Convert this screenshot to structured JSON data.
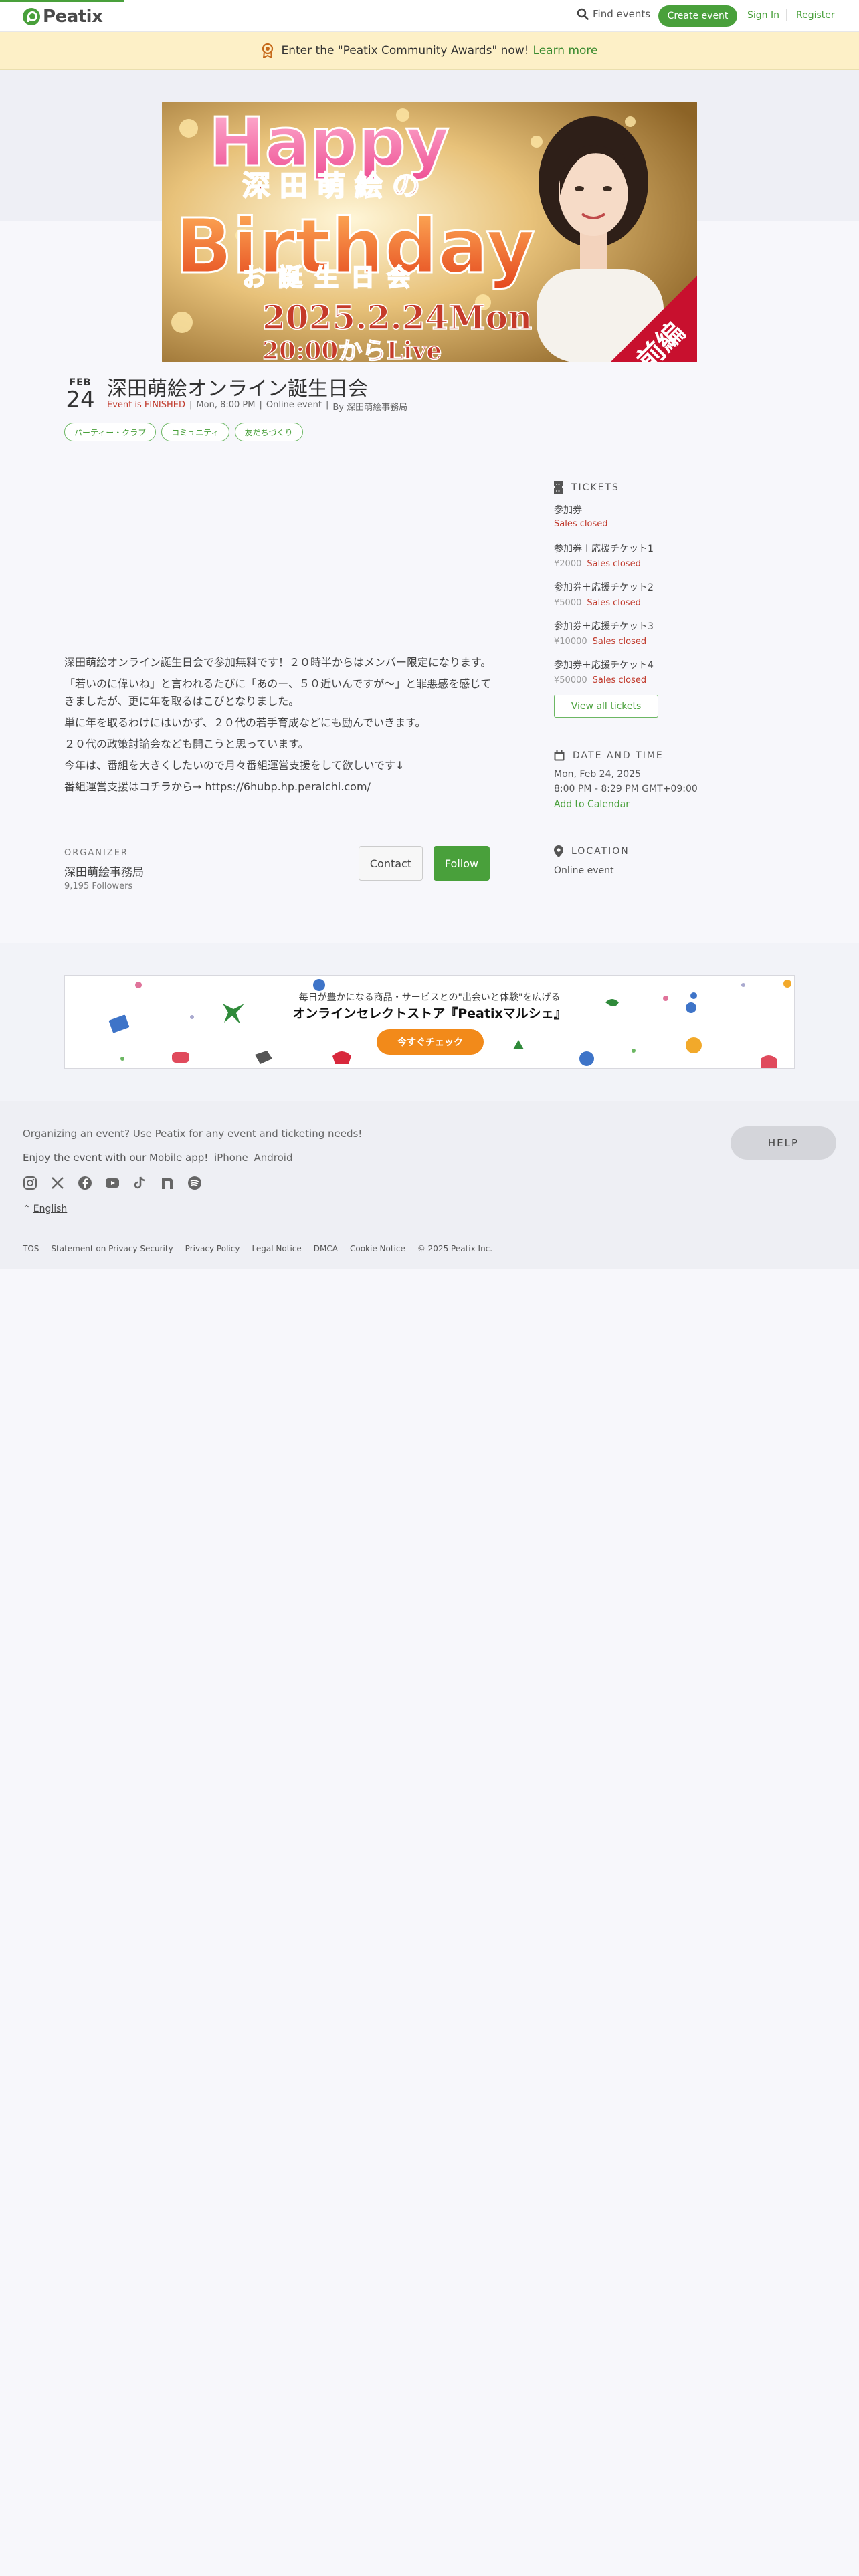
{
  "header": {
    "logo_text": "Peatix",
    "find_events": "Find events",
    "create_event": "Create event",
    "sign_in": "Sign In",
    "register": "Register"
  },
  "banner": {
    "text": "Enter the \"Peatix Community Awards\" now!",
    "link": "Learn more"
  },
  "hero": {
    "line1": "Happy",
    "line2": "深田萌絵の",
    "line3": "Birthday",
    "line4": "お誕生日会",
    "date": "2025.2.24Mon",
    "time": "20:00からLive",
    "corner": "前編"
  },
  "event": {
    "month": "FEB",
    "day": "24",
    "title": "深田萌絵オンライン誕生日会",
    "status": "Event is FINISHED",
    "datetime": "Mon, 8:00 PM",
    "venue": "Online event",
    "by": "By 深田萌絵事務局",
    "tags": [
      "パーティー・クラブ",
      "コミュニティ",
      "友だちづくり"
    ]
  },
  "description": [
    "深田萌絵オンライン誕生日会で参加無料です！２０時半からはメンバー限定になります。",
    "「若いのに偉いね」と言われるたびに「あのー、５０近いんですが〜」と罪悪感を感じてきましたが、更に年を取るはこびとなりました。",
    "単に年を取るわけにはいかず、２０代の若手育成などにも励んでいきます。",
    "２０代の政策討論会なども開こうと思っています。",
    "今年は、番組を大きくしたいので月々番組運営支援をして欲しいです↓",
    "番組運営支援はコチラから→ https://6hubp.hp.peraichi.com/"
  ],
  "organizer": {
    "label": "ORGANIZER",
    "name": "深田萌絵事務局",
    "followers": "9,195 Followers",
    "contact": "Contact",
    "follow": "Follow"
  },
  "tickets": {
    "heading": "TICKETS",
    "items": [
      {
        "name": "参加券",
        "price": "",
        "status": "Sales closed"
      },
      {
        "name": "参加券＋応援チケット1",
        "price": "¥2000",
        "status": "Sales closed"
      },
      {
        "name": "参加券＋応援チケット2",
        "price": "¥5000",
        "status": "Sales closed"
      },
      {
        "name": "参加券＋応援チケット3",
        "price": "¥10000",
        "status": "Sales closed"
      },
      {
        "name": "参加券＋応援チケット4",
        "price": "¥50000",
        "status": "Sales closed"
      }
    ],
    "view_all": "View all tickets"
  },
  "datetime": {
    "heading": "DATE AND TIME",
    "date": "Mon, Feb 24, 2025",
    "time": "8:00 PM - 8:29 PM GMT+09:00",
    "add": "Add to Calendar"
  },
  "location": {
    "heading": "LOCATION",
    "value": "Online event"
  },
  "ad": {
    "small": "毎日が豊かになる商品・サービスとの\"出会いと体験\"を広げる",
    "big": "オンラインセレクトストア『Peatixマルシェ』",
    "button": "今すぐチェック"
  },
  "footer": {
    "organizing": "Organizing an event? Use Peatix for any event and ticketing needs!",
    "app_text": "Enjoy the event with our Mobile app!",
    "iphone": "iPhone",
    "android": "Android",
    "language": "English",
    "legal": [
      "TOS",
      "Statement on Privacy Security",
      "Privacy Policy",
      "Legal Notice",
      "DMCA",
      "Cookie Notice",
      "© 2025 Peatix Inc."
    ],
    "help": "HELP"
  },
  "colors": {
    "brand": "#49a03b",
    "closed": "#c0392b",
    "banner": "#fdf0c7",
    "ad_button": "#f28a1a"
  }
}
